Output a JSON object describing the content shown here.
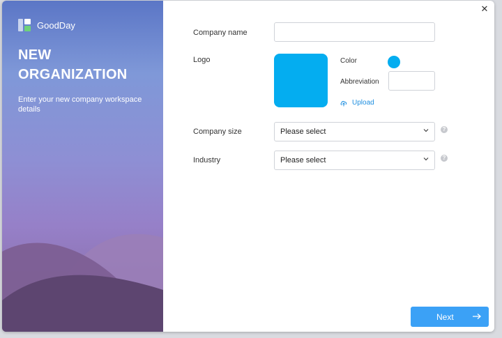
{
  "brand": {
    "name": "GoodDay"
  },
  "side": {
    "title_line1": "NEW",
    "title_line2": "ORGANIZATION",
    "subtitle": "Enter your new company workspace details"
  },
  "form": {
    "company_name": {
      "label": "Company name",
      "value": ""
    },
    "logo": {
      "label": "Logo",
      "color_label": "Color",
      "color_value": "#04adf0",
      "abbreviation_label": "Abbreviation",
      "abbreviation_value": "",
      "upload_label": "Upload",
      "upload_icon": "upload-cloud-icon"
    },
    "company_size": {
      "label": "Company size",
      "selected": "Please select"
    },
    "industry": {
      "label": "Industry",
      "selected": "Please select"
    }
  },
  "footer": {
    "next_label": "Next",
    "next_icon": "arrow-right-icon"
  },
  "colors": {
    "accent": "#3ba1f6",
    "logo": "#04adf0"
  }
}
